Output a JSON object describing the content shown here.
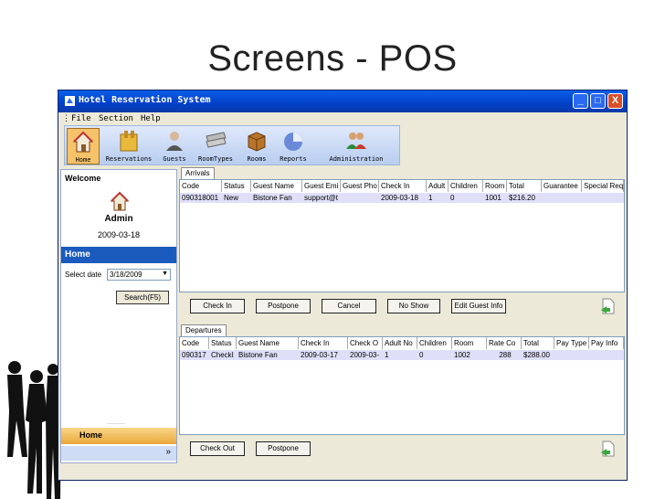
{
  "slide": {
    "title": "Screens - POS"
  },
  "window": {
    "title": "Hotel Reservation System",
    "buttons": {
      "minimize": "_",
      "maximize": "□",
      "close": "X"
    }
  },
  "menu": {
    "items": [
      "File",
      "Section",
      "Help"
    ]
  },
  "toolbar": {
    "items": [
      {
        "label": "Home",
        "icon": "home-icon"
      },
      {
        "label": "Reservations",
        "icon": "reservations-icon"
      },
      {
        "label": "Guests",
        "icon": "guests-icon"
      },
      {
        "label": "RoomTypes",
        "icon": "roomtypes-icon"
      },
      {
        "label": "Rooms",
        "icon": "rooms-icon"
      },
      {
        "label": "Reports",
        "icon": "reports-icon"
      },
      {
        "label": "Administration",
        "icon": "administration-icon"
      }
    ]
  },
  "left": {
    "welcome": "Welcome",
    "user": "Admin",
    "date": "2009-03-18",
    "section_title": "Home",
    "select_label": "Select date",
    "select_value": "3/18/2009",
    "search_button": "Search(F5)",
    "home_button": "Home",
    "more": "»"
  },
  "arrivals": {
    "tab": "Arrivals",
    "columns": [
      "Code",
      "Status",
      "Guest Name",
      "Guest Emi",
      "Guest Pho",
      "Check In",
      "Adult",
      "Children",
      "Room",
      "Total",
      "Guarantee",
      "Special Req"
    ],
    "rows": [
      [
        "090318001",
        "New",
        "Bistone Fan",
        "support@t",
        "",
        "2009-03-18",
        "1",
        "0",
        "1001",
        "$216.20",
        "",
        ""
      ]
    ],
    "buttons": [
      "Check In",
      "Postpone",
      "Cancel",
      "No Show",
      "Edit Guest Info"
    ]
  },
  "departures": {
    "tab": "Departures",
    "columns": [
      "Code",
      "Status",
      "Guest Name",
      "Check In",
      "Check O",
      "Adult No",
      "Children",
      "Room",
      "Rate Co",
      "Total",
      "Pay Type",
      "Pay Info"
    ],
    "rows": [
      [
        "090317",
        "CheckI",
        "Bistone Fan",
        "2009-03-17",
        "2009-03-",
        "1",
        "0",
        "1002",
        "288",
        "$288.00",
        "",
        ""
      ]
    ],
    "buttons": [
      "Check Out",
      "Postpone"
    ]
  },
  "colors": {
    "title_bar": "#0a5ee8",
    "section_blue": "#1b5bbd",
    "selected_row": "#dfe0f8",
    "home_orange": "#e9a83a"
  }
}
